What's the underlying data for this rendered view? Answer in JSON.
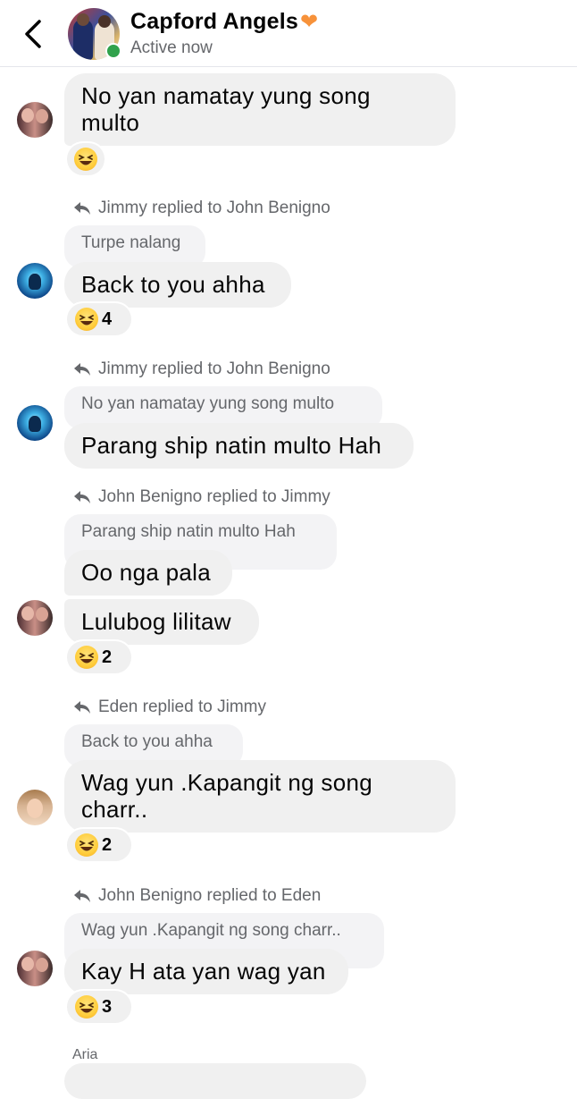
{
  "header": {
    "title": "Capford Angels",
    "status": "Active now"
  },
  "messages": [
    {
      "text_line1": "No yan namatay yung song",
      "text_line2": "multo",
      "reaction_count": ""
    },
    {
      "reply_label": "Jimmy replied to John Benigno",
      "quote": "Turpe nalang",
      "text": "Back to you ahha",
      "reaction_count": "4"
    },
    {
      "reply_label": "Jimmy replied to John Benigno",
      "quote": "No yan namatay yung song multo",
      "text": "Parang ship natin multo Hah"
    },
    {
      "reply_label": "John Benigno replied to Jimmy",
      "quote": "Parang ship natin multo Hah",
      "text": "Oo nga pala"
    },
    {
      "text": "Lulubog lilitaw",
      "reaction_count": "2"
    },
    {
      "reply_label": "Eden replied to Jimmy",
      "quote": "Back to you ahha",
      "text_line1": "Wag yun .Kapangit ng song",
      "text_line2": "charr..",
      "reaction_count": "2"
    },
    {
      "reply_label": "John Benigno replied to Eden",
      "quote": "Wag yun .Kapangit ng song charr..",
      "text": "Kay H ata yan wag yan",
      "reaction_count": "3"
    }
  ],
  "next_sender": "Aria",
  "colors": {
    "bubble": "#f0f0f0",
    "secondary_text": "#65676b",
    "online": "#31a24c",
    "heart": "#f7923a"
  },
  "icons": {
    "back": "chevron-left-icon",
    "reply": "reply-arrow-icon",
    "reaction": "laughing-emoji-icon",
    "heart": "orange-heart-icon"
  }
}
